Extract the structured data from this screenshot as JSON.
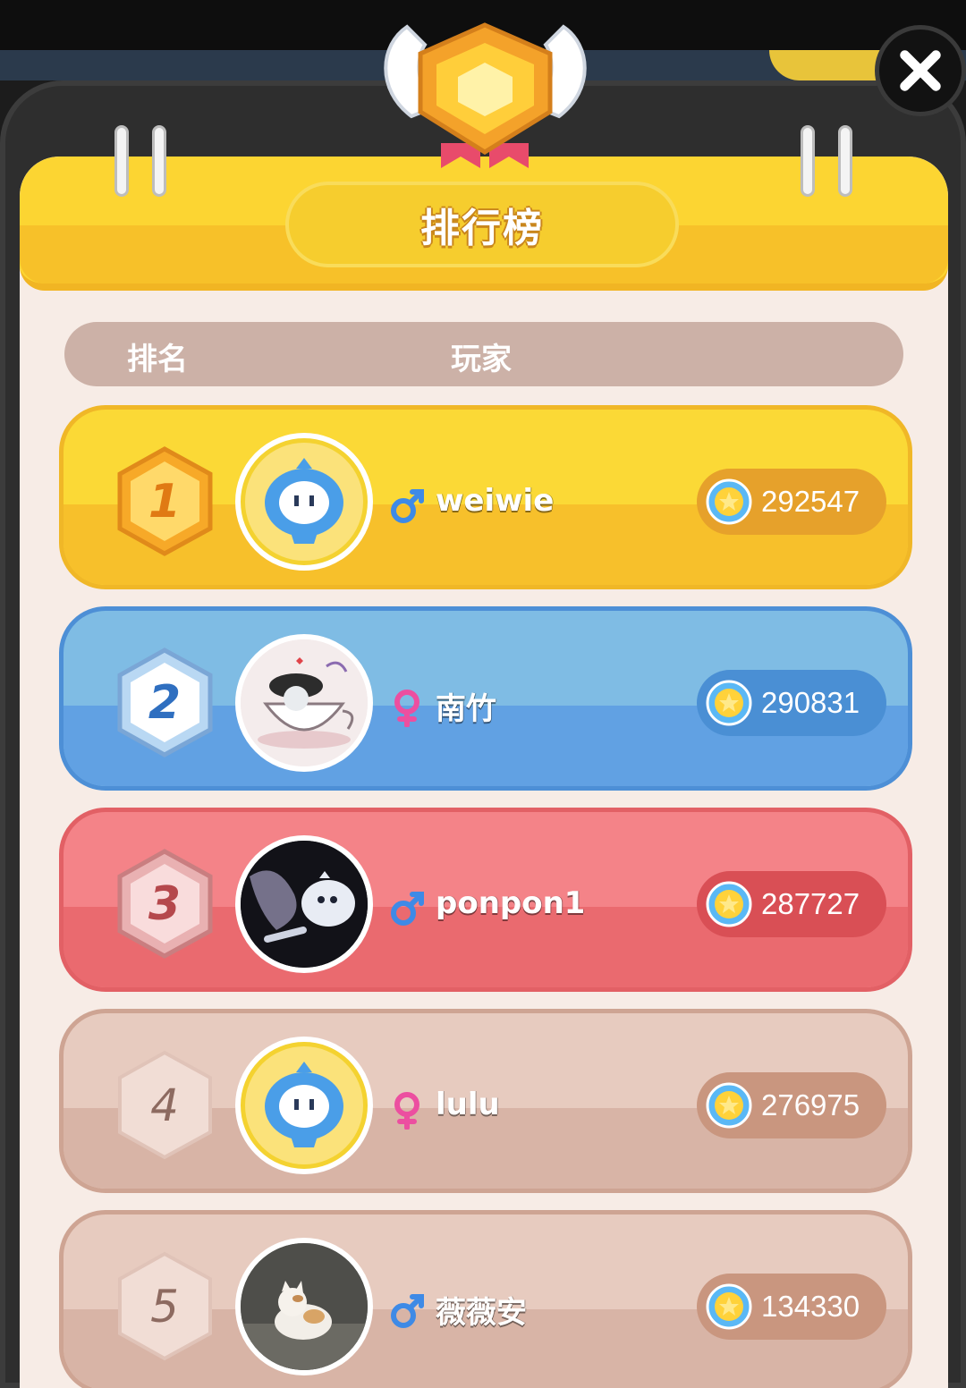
{
  "header": {
    "title": "排行榜"
  },
  "columns": {
    "rank": "排名",
    "player": "玩家"
  },
  "colors": {
    "gold": "#fbd936",
    "silver_blue": "#7fbce4",
    "bronze_red": "#f48388",
    "default_row": "#e7cbbf"
  },
  "players": [
    {
      "rank": "1",
      "name": "weiwie",
      "gender": "male-icon",
      "score": "292547"
    },
    {
      "rank": "2",
      "name": "南竹",
      "gender": "female-icon",
      "score": "290831"
    },
    {
      "rank": "3",
      "name": "ponpon1",
      "gender": "male-icon",
      "score": "287727"
    },
    {
      "rank": "4",
      "name": "lulu",
      "gender": "female-icon",
      "score": "276975"
    },
    {
      "rank": "5",
      "name": "薇薇安",
      "gender": "male-icon",
      "score": "134330"
    }
  ]
}
